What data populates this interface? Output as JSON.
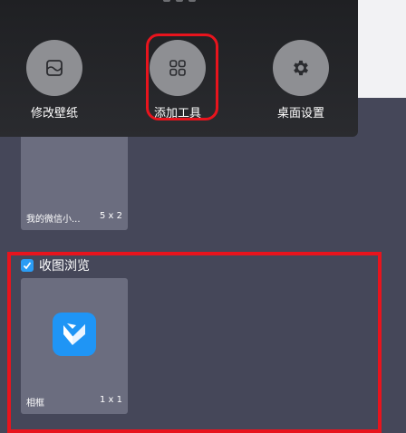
{
  "popup": {
    "items": [
      {
        "label": "修改壁纸",
        "icon": "wallpaper-icon"
      },
      {
        "label": "添加工具",
        "icon": "grid-icon"
      },
      {
        "label": "桌面设置",
        "icon": "gear-icon"
      }
    ]
  },
  "widgets": [
    {
      "name": "我的微信小...",
      "size": "5 x 2"
    }
  ],
  "section": {
    "title": "收图浏览",
    "icon": "checkbox-icon",
    "items": [
      {
        "name": "相框",
        "size": "1 x 1",
        "icon": "photo-frame-app-icon"
      }
    ]
  },
  "colors": {
    "highlight": "#e8141d",
    "accent": "#1f95f5"
  }
}
